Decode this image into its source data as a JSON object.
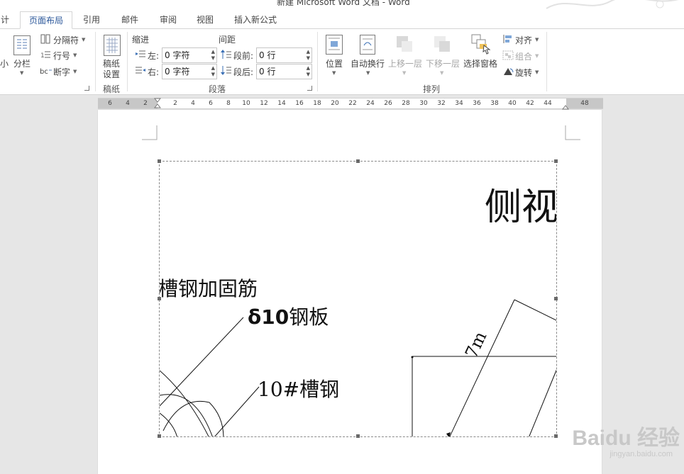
{
  "window": {
    "title": "新建 Microsoft Word 文档 - Word"
  },
  "tabs": [
    {
      "label": "计"
    },
    {
      "label": "页面布局"
    },
    {
      "label": "引用"
    },
    {
      "label": "邮件"
    },
    {
      "label": "审阅"
    },
    {
      "label": "视图"
    },
    {
      "label": "插入新公式"
    }
  ],
  "ribbon": {
    "page_setup": {
      "size_label": "小",
      "columns_label": "分栏",
      "breaks_label": "分隔符",
      "line_numbers_label": "行号",
      "hyphenation_label": "断字"
    },
    "manuscript": {
      "settings_label": "稿纸\n设置",
      "settings_line1": "稿纸",
      "settings_line2": "设置",
      "group_label": "稿纸"
    },
    "paragraph": {
      "indent_heading": "缩进",
      "spacing_heading": "间距",
      "indent_left_label": "左:",
      "indent_left_value": "0 字符",
      "indent_right_label": "右:",
      "indent_right_value": "0 字符",
      "spacing_before_label": "段前:",
      "spacing_before_value": "0 行",
      "spacing_after_label": "段后:",
      "spacing_after_value": "0 行",
      "group_label": "段落"
    },
    "arrange": {
      "position_label": "位置",
      "wrap_text_label": "自动换行",
      "bring_forward_label": "上移一层",
      "send_backward_label": "下移一层",
      "selection_pane_label": "选择窗格",
      "align_label": "对齐",
      "group_label_btn": "组合",
      "rotate_label": "旋转",
      "group_label": "排列"
    }
  },
  "ruler": {
    "ticks": [
      "6",
      "4",
      "2",
      "2",
      "4",
      "6",
      "8",
      "10",
      "12",
      "14",
      "16",
      "18",
      "20",
      "22",
      "24",
      "26",
      "28",
      "30",
      "32",
      "34",
      "36",
      "38",
      "40",
      "42",
      "44",
      "48"
    ]
  },
  "drawing": {
    "title": "侧视",
    "label_reinforce": "槽钢加固筋",
    "label_plate_prefix": "δ10",
    "label_plate_suffix": "钢板",
    "label_channel": "10#槽钢",
    "label_dim": "7m"
  },
  "watermark": {
    "brand": "Baidu 经验",
    "url": "jingyan.baidu.com"
  }
}
